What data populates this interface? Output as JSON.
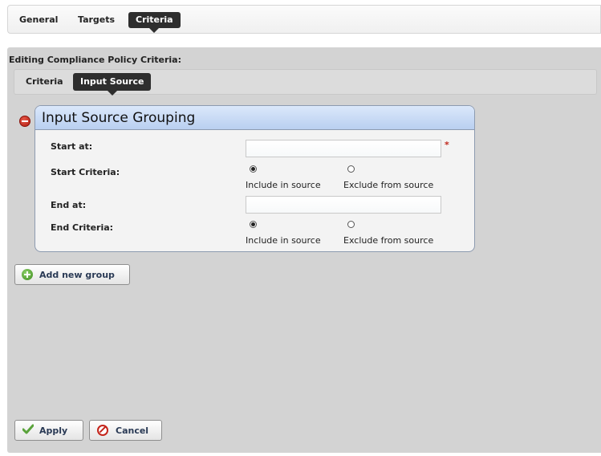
{
  "tabs": [
    {
      "label": "General",
      "active": false
    },
    {
      "label": "Targets",
      "active": false
    },
    {
      "label": "Criteria",
      "active": true
    }
  ],
  "panel": {
    "title": "Editing Compliance Policy Criteria:",
    "subtabs": [
      {
        "label": "Criteria",
        "active": false
      },
      {
        "label": "Input Source",
        "active": true
      }
    ]
  },
  "grouping": {
    "title": "Input Source Grouping",
    "start_at": {
      "label": "Start at:",
      "value": "",
      "required_marker": "*"
    },
    "start_criteria": {
      "label": "Start Criteria:",
      "options": [
        "Include in source",
        "Exclude from source"
      ],
      "selected": "Include in source"
    },
    "end_at": {
      "label": "End at:",
      "value": ""
    },
    "end_criteria": {
      "label": "End Criteria:",
      "options": [
        "Include in source",
        "Exclude from source"
      ],
      "selected": "Include in source"
    }
  },
  "actions": {
    "add_group_label": "Add new group",
    "apply_label": "Apply",
    "cancel_label": "Cancel"
  },
  "icons": {
    "remove": "remove-group-icon",
    "add": "add-icon",
    "apply": "check-icon",
    "cancel": "cancel-icon"
  },
  "colors": {
    "tab_active_bg": "#2e2e2e",
    "panel_bg": "#d3d3d3",
    "card_header": "#c9dbf5",
    "remove_red": "#c4241a",
    "add_green": "#4a9a25"
  }
}
